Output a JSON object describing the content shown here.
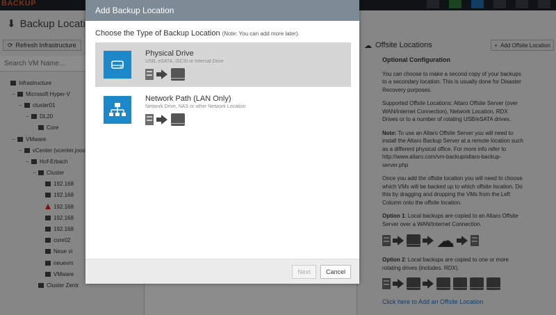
{
  "app": {
    "logo_text": "BACKUP"
  },
  "left": {
    "title": "Backup Locations",
    "refresh_label": "Refresh Infrastructure",
    "search_placeholder": "Search VM Name...",
    "tree": [
      {
        "label": "Infrastructure",
        "depth": 0,
        "toggle": "",
        "icon": "network-icon"
      },
      {
        "label": "Microsoft Hyper-V",
        "depth": 1,
        "toggle": "−",
        "icon": "windows-icon"
      },
      {
        "label": "cluster01",
        "depth": 2,
        "toggle": "−",
        "icon": "cluster-icon"
      },
      {
        "label": "DL20",
        "depth": 3,
        "toggle": "−",
        "icon": "host-icon"
      },
      {
        "label": "Core",
        "depth": 4,
        "toggle": "",
        "icon": "vm-icon"
      },
      {
        "label": "VMware",
        "depth": 1,
        "toggle": "−",
        "icon": "vmware-icon"
      },
      {
        "label": "vCenter (vcenter.joos.lo",
        "depth": 2,
        "toggle": "−",
        "icon": "vcenter-icon"
      },
      {
        "label": "Hof-Erbach",
        "depth": 3,
        "toggle": "−",
        "icon": "datacenter-icon"
      },
      {
        "label": "Cluster",
        "depth": 4,
        "toggle": "−",
        "icon": "cluster-icon"
      },
      {
        "label": "192.168",
        "depth": 5,
        "toggle": "",
        "icon": "host-icon"
      },
      {
        "label": "192.168",
        "depth": 5,
        "toggle": "",
        "icon": "host-icon"
      },
      {
        "label": "192.168",
        "depth": 5,
        "toggle": "",
        "icon": "warning-icon"
      },
      {
        "label": "192.168",
        "depth": 5,
        "toggle": "",
        "icon": "host-icon"
      },
      {
        "label": "192.168",
        "depth": 5,
        "toggle": "",
        "icon": "host-icon"
      },
      {
        "label": "core02",
        "depth": 5,
        "toggle": "",
        "icon": "vm-icon"
      },
      {
        "label": "Neue vi",
        "depth": 5,
        "toggle": "",
        "icon": "vm-icon"
      },
      {
        "label": "neuevm",
        "depth": 5,
        "toggle": "",
        "icon": "vm-icon"
      },
      {
        "label": "VMware",
        "depth": 5,
        "toggle": "",
        "icon": "vm-icon"
      },
      {
        "label": "Cluster Zentr",
        "depth": 4,
        "toggle": "",
        "icon": "cluster-icon"
      }
    ]
  },
  "right": {
    "title": "Offsite Locations",
    "add_label": "Add Offsite Location",
    "heading": "Optional Configuration",
    "p1": "You can choose to make a second copy of your backups to a secondary location. This is usually done for Disaster Recovery purposes.",
    "p2": "Supported Offsite Locations: Altaro Offsite Server (over WAN/Internet Connection), Network Location, RDX Drives or to a number of rotating USB/eSATA drives.",
    "note_label": "Note:",
    "note_text": " To use an Altaro Offsite Server you will need to install the Altaro Backup Server at a remote location such as a different physical office. For more info refer to http://www.altaro.com/vm-backup/altaro-backup-server.php",
    "p3": "Once you add the offsite location you will need to choose which VMs will be backed up to which offsite location. Do this by dragging and dropping the VMs from the Left Column onto the offsite location.",
    "opt1_label": "Option 1",
    "opt1_text": ": Local backups are copied to an Altaro Offsite Server over a WAN/Internet Connection.",
    "opt2_label": "Option 2",
    "opt2_text": ": Local backups are copied to one or more rotating drives (includes. RDX).",
    "link": "Click here to Add an Offsite Location"
  },
  "modal": {
    "title": "Add Backup Location",
    "subtitle": "Choose the Type of Backup Location",
    "subtitle_note": "(Note: You can add more later).",
    "options": [
      {
        "title": "Physical Drive",
        "desc": "USB, eSATA, iSCSI or Internal Drive",
        "icon": "hard-drive-icon",
        "selected": true
      },
      {
        "title": "Network Path (LAN Only)",
        "desc": "Network Drive, NAS or other Network Location",
        "icon": "network-tree-icon",
        "selected": false
      }
    ],
    "next_label": "Next",
    "cancel_label": "Cancel"
  },
  "colors": {
    "accent": "#1d88c9",
    "header": "#7d8b96",
    "logo": "#e85a1e"
  }
}
